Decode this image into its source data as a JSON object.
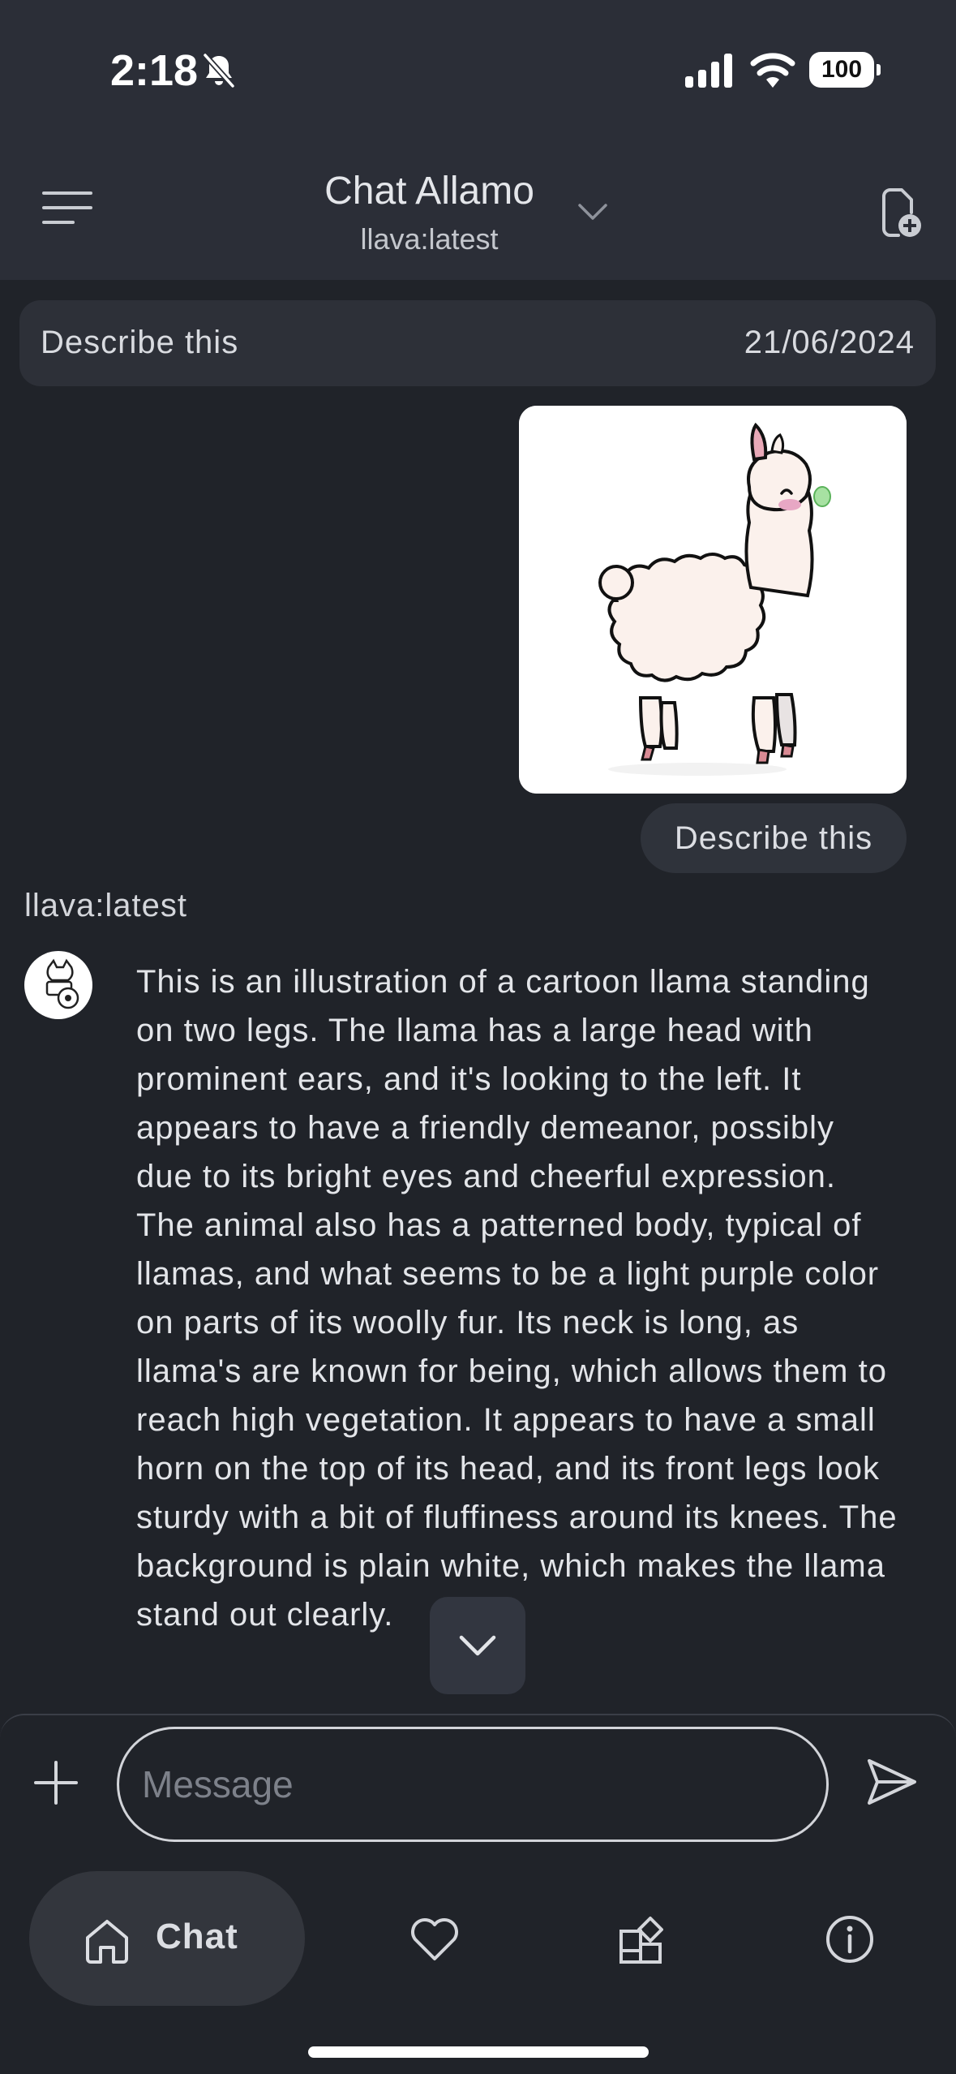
{
  "status_bar": {
    "time": "2:18",
    "battery": "100"
  },
  "header": {
    "title": "Chat Allamo",
    "model": "llava:latest"
  },
  "conversation": {
    "title": "Describe this",
    "date": "21/06/2024"
  },
  "messages": {
    "user_text": "Describe this",
    "model_name": "llava:latest",
    "answer": "This is an illustration of a cartoon llama standing on two legs. The llama has a large head with prominent ears, and it's looking to the left. It appears to have a friendly demeanor, possibly due to its bright eyes and cheerful expression. The animal also has a patterned body, typical of llamas, and what seems to be a light purple color on parts of its woolly fur. Its neck is long, as llama's are known for being, which allows them to reach high vegetation. It appears to have a small horn on the top of its head, and its front legs look sturdy with a bit of fluffiness around its knees. The background is plain white, which makes the llama stand out clearly."
  },
  "composer": {
    "placeholder": "Message"
  },
  "nav": {
    "chat_label": "Chat"
  },
  "icons": [
    "bell-off-icon",
    "signal-icon",
    "wifi-icon",
    "menu-icon",
    "chevron-down-icon",
    "new-chat-icon",
    "plus-icon",
    "send-icon",
    "home-icon",
    "heart-icon",
    "widgets-icon",
    "info-icon"
  ],
  "colors": {
    "background": "#202329",
    "header": "#2b2e37",
    "bubble": "#2f333b"
  }
}
